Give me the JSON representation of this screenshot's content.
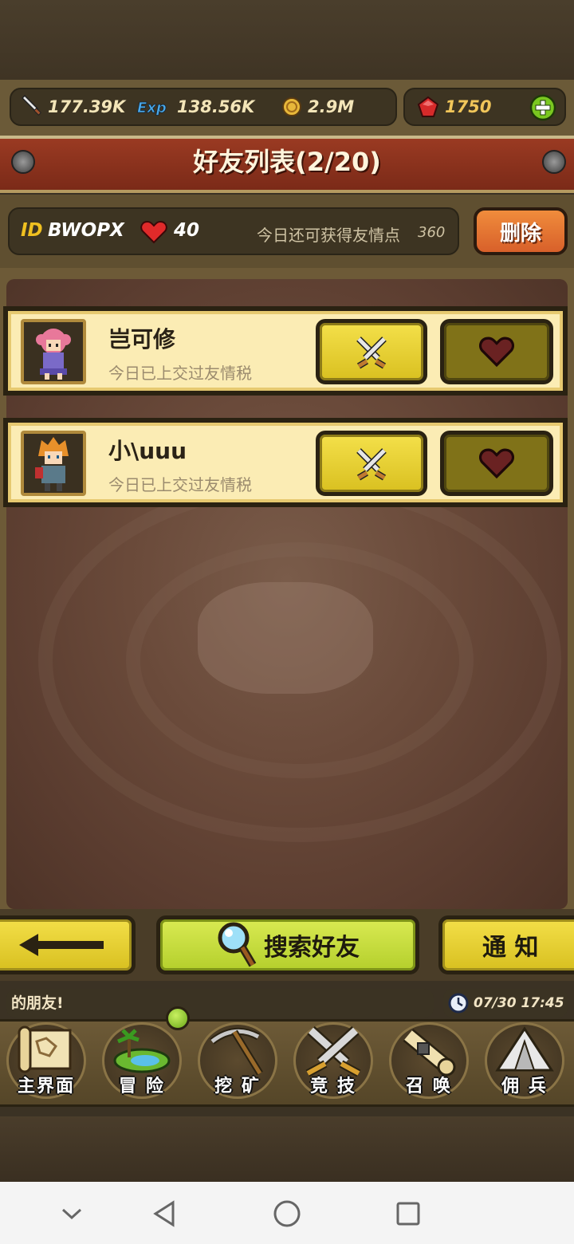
{
  "resources": {
    "attack": "177.39K",
    "exp": "138.56K",
    "gold": "2.9M",
    "gems": "1750"
  },
  "title": "好友列表(2/20)",
  "info": {
    "id_label": "ID",
    "id_value": "BWOPX",
    "hearts": "40",
    "friendship_text": "今日还可获得友情点",
    "friendship_points": "360",
    "delete_label": "删除"
  },
  "friends": [
    {
      "name": "岂可修",
      "status": "今日已上交过友情税"
    },
    {
      "name": "小\\uuu",
      "status": "今日已上交过友情税"
    }
  ],
  "buttons": {
    "search_label": "搜索好友",
    "notify_label": "通 知"
  },
  "news": {
    "ticker": "的朋友!",
    "clock": "07/30 17:45"
  },
  "nav": [
    {
      "label": "主界面",
      "icon": "map-scroll-icon"
    },
    {
      "label": "冒 险",
      "icon": "island-icon"
    },
    {
      "label": "挖 矿",
      "icon": "pickaxe-icon"
    },
    {
      "label": "竞 技",
      "icon": "crossed-swords-icon"
    },
    {
      "label": "召 唤",
      "icon": "summon-scroll-icon"
    },
    {
      "label": "佣 兵",
      "icon": "tent-icon"
    }
  ],
  "colors": {
    "banner": "#8a3220",
    "card": "#fbecb4",
    "yellow_button": "#e6cf30",
    "green_button": "#c6dd40",
    "delete_button": "#e27534"
  }
}
